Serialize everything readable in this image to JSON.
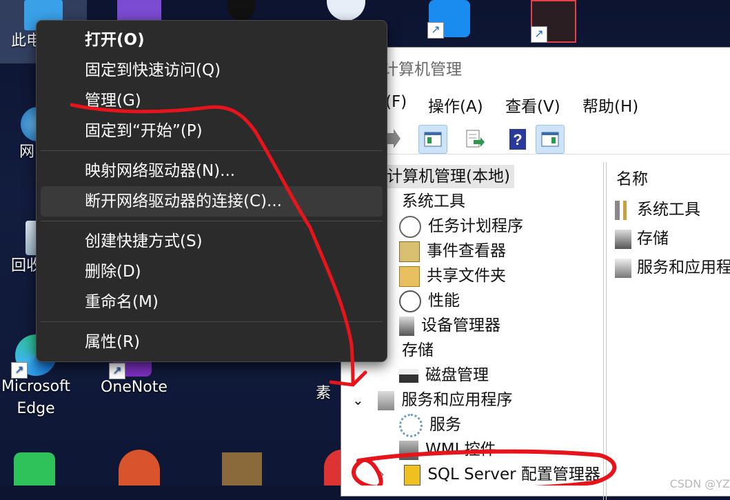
{
  "desktop": {
    "icons": [
      {
        "label": "此电",
        "icon": "this-pc-icon"
      },
      {
        "label": "网",
        "icon": "network-icon"
      },
      {
        "label": "回收",
        "icon": "recycle-bin-icon"
      },
      {
        "label": "Microsoft Edge",
        "line1": "Microsoft",
        "line2": "Edge",
        "icon": "edge-icon"
      },
      {
        "label": "OneNote",
        "icon": "onenote-icon"
      },
      {
        "label": "素",
        "icon": "folder-icon"
      }
    ]
  },
  "context_menu": {
    "items": [
      {
        "label": "打开(O)"
      },
      {
        "label": "固定到快速访问(Q)"
      },
      {
        "label": "管理(G)"
      },
      {
        "label": "固定到“开始”(P)"
      },
      {
        "label": "映射网络驱动器(N)..."
      },
      {
        "label": "断开网络驱动器的连接(C)..."
      },
      {
        "label": "创建快捷方式(S)"
      },
      {
        "label": "删除(D)"
      },
      {
        "label": "重命名(M)"
      },
      {
        "label": "属性(R)"
      }
    ]
  },
  "mmc": {
    "title": "计算机管理",
    "menu": [
      "(F)",
      "操作(A)",
      "查看(V)",
      "帮助(H)"
    ],
    "tree": {
      "root": "计算机管理(本地)",
      "system_tools": "系统工具",
      "task_scheduler": "任务计划程序",
      "event_viewer": "事件查看器",
      "shared_folders": "共享文件夹",
      "performance": "性能",
      "device_manager": "设备管理器",
      "storage": "存储",
      "disk_management": "磁盘管理",
      "services_apps": "服务和应用程序",
      "services": "服务",
      "wmi": "WMI 控件",
      "sql": "SQL Server 配置管理器"
    },
    "list": {
      "header": "名称",
      "items": [
        "系统工具",
        "存储",
        "服务和应用程"
      ]
    }
  },
  "watermark": "CSDN @YZ",
  "colors": {
    "annotation_red": "#e8141c",
    "menu_bg": "#2b2b2b",
    "selection": "#cde3f7"
  }
}
